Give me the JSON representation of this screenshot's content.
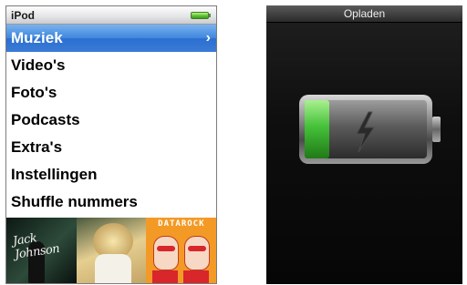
{
  "ipod_menu": {
    "title": "iPod",
    "items": [
      {
        "label": "Muziek",
        "selected": true
      },
      {
        "label": "Video's"
      },
      {
        "label": "Foto's"
      },
      {
        "label": "Podcasts"
      },
      {
        "label": "Extra's"
      },
      {
        "label": "Instellingen"
      },
      {
        "label": "Shuffle nummers"
      }
    ],
    "chevron": "›",
    "battery_level": 1.0,
    "album_art": [
      {
        "icon": "album-art-jack-johnson",
        "text": "Jack Johnson"
      },
      {
        "icon": "album-art-singer"
      },
      {
        "icon": "album-art-datarock",
        "text": "DATAROCK"
      }
    ]
  },
  "charging_screen": {
    "title": "Opladen",
    "battery_fill": 0.2,
    "icon": "lightning-bolt-icon",
    "colors": {
      "charge": "#46c13a",
      "selection": "#3f86dd"
    }
  }
}
